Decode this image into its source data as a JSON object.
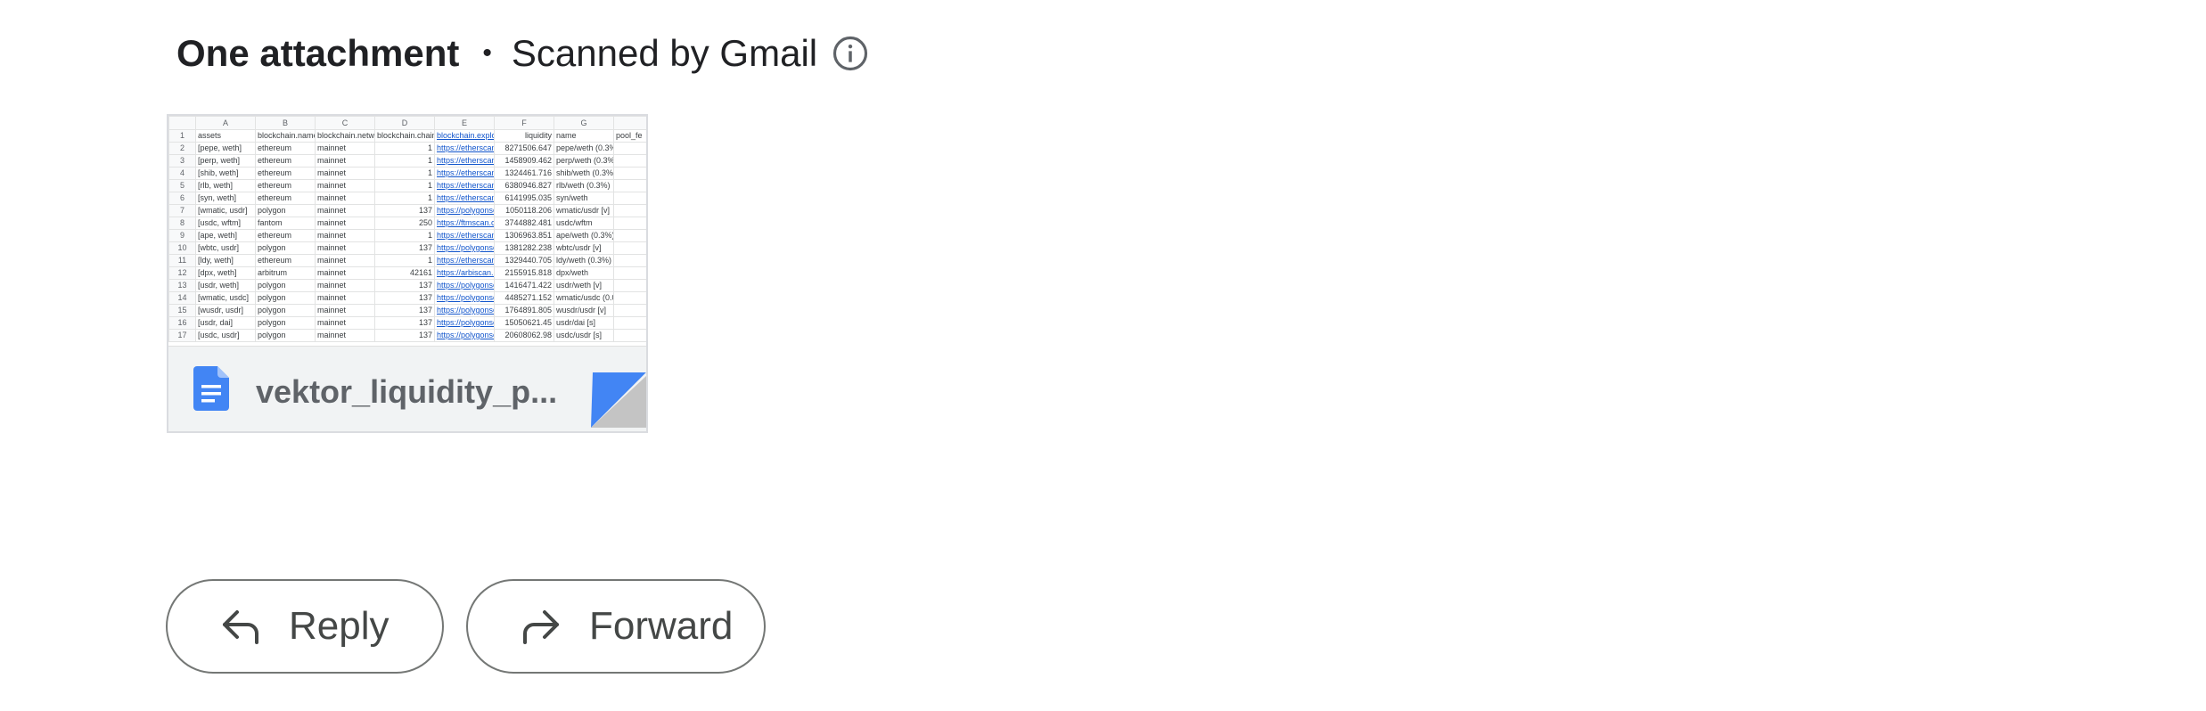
{
  "attachments": {
    "count_label": "One attachment",
    "separator": "•",
    "scanned_label": "Scanned by Gmail",
    "info_icon": "info-icon"
  },
  "file": {
    "name": "vektor_liquidity_p...",
    "type_icon": "google-docs-icon",
    "icon_color": "#4285f4"
  },
  "sheet_preview": {
    "columns": [
      "A",
      "B",
      "C",
      "D",
      "E",
      "F",
      "G",
      ""
    ],
    "header": [
      "assets",
      "blockchain.name",
      "blockchain.netwo",
      "blockchain.chain",
      "blockchain.explo",
      "liquidity",
      "name",
      "pool_fe"
    ],
    "rows": [
      [
        "[pepe, weth]",
        "ethereum",
        "mainnet",
        "1",
        "https://etherscan",
        "8271506.647",
        "pepe/weth (0.3%",
        ""
      ],
      [
        "[perp, weth]",
        "ethereum",
        "mainnet",
        "1",
        "https://etherscan",
        "1458909.462",
        "perp/weth (0.3%",
        ""
      ],
      [
        "[shib, weth]",
        "ethereum",
        "mainnet",
        "1",
        "https://etherscan",
        "1324461.716",
        "shib/weth (0.3%)",
        ""
      ],
      [
        "[rlb, weth]",
        "ethereum",
        "mainnet",
        "1",
        "https://etherscan",
        "6380946.827",
        "rlb/weth (0.3%)",
        ""
      ],
      [
        "[syn, weth]",
        "ethereum",
        "mainnet",
        "1",
        "https://etherscan",
        "6141995.035",
        "syn/weth",
        ""
      ],
      [
        "[wmatic, usdr]",
        "polygon",
        "mainnet",
        "137",
        "https://polygonsc",
        "1050118.206",
        "wmatic/usdr [v]",
        ""
      ],
      [
        "[usdc, wftm]",
        "fantom",
        "mainnet",
        "250",
        "https://ftmscan.c",
        "3744882.481",
        "usdc/wftm",
        ""
      ],
      [
        "[ape, weth]",
        "ethereum",
        "mainnet",
        "1",
        "https://etherscan",
        "1306963.851",
        "ape/weth (0.3%)",
        ""
      ],
      [
        "[wbtc, usdr]",
        "polygon",
        "mainnet",
        "137",
        "https://polygonsc",
        "1381282.238",
        "wbtc/usdr [v]",
        ""
      ],
      [
        "[ldy, weth]",
        "ethereum",
        "mainnet",
        "1",
        "https://etherscan",
        "1329440.705",
        "ldy/weth (0.3%)",
        ""
      ],
      [
        "[dpx, weth]",
        "arbitrum",
        "mainnet",
        "42161",
        "https://arbiscan.i",
        "2155915.818",
        "dpx/weth",
        ""
      ],
      [
        "[usdr, weth]",
        "polygon",
        "mainnet",
        "137",
        "https://polygonsc",
        "1416471.422",
        "usdr/weth [v]",
        ""
      ],
      [
        "[wmatic, usdc]",
        "polygon",
        "mainnet",
        "137",
        "https://polygonsc",
        "4485271.152",
        "wmatic/usdc (0.0",
        ""
      ],
      [
        "[wusdr, usdr]",
        "polygon",
        "mainnet",
        "137",
        "https://polygonsc",
        "1764891.805",
        "wusdr/usdr [v]",
        ""
      ],
      [
        "[usdr, dai]",
        "polygon",
        "mainnet",
        "137",
        "https://polygonsc",
        "15050621.45",
        "usdr/dai [s]",
        ""
      ],
      [
        "[usdc, usdr]",
        "polygon",
        "mainnet",
        "137",
        "https://polygonsc",
        "20608062.98",
        "usdc/usdr [s]",
        ""
      ]
    ]
  },
  "actions": {
    "reply_label": "Reply",
    "reply_icon": "reply-icon",
    "forward_label": "Forward",
    "forward_icon": "forward-icon"
  }
}
